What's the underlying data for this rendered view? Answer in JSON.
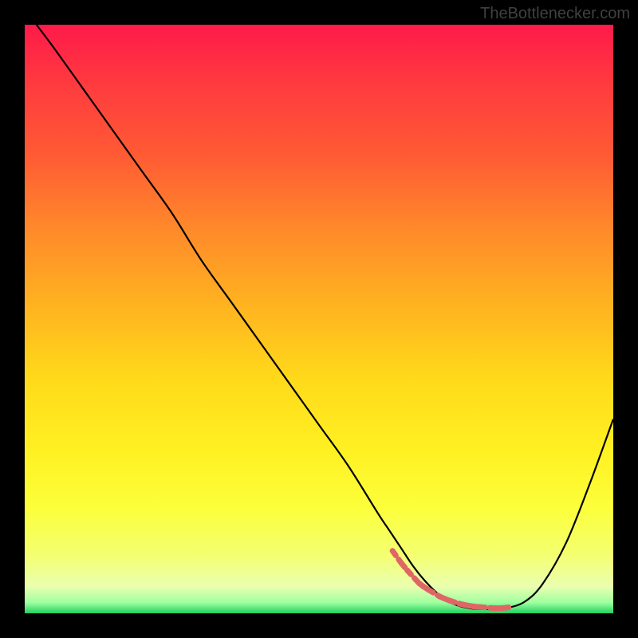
{
  "attribution": "TheBottlenecker.com",
  "chart_data": {
    "type": "line",
    "title": "",
    "xlabel": "",
    "ylabel": "",
    "xlim": [
      0,
      100
    ],
    "ylim": [
      0,
      100
    ],
    "grid": false,
    "series": [
      {
        "name": "bottleneck-curve",
        "color": "#000000",
        "x": [
          2,
          5,
          10,
          15,
          20,
          25,
          30,
          35,
          40,
          45,
          50,
          55,
          60,
          62,
          64,
          66,
          68,
          70,
          72,
          74,
          76,
          78,
          80,
          82,
          85,
          88,
          92,
          96,
          100
        ],
        "y": [
          100,
          96,
          89,
          82,
          75,
          68,
          60,
          53,
          46,
          39,
          32,
          25,
          17,
          14,
          11,
          8,
          5.5,
          3.5,
          2,
          1.2,
          0.8,
          0.7,
          0.7,
          0.9,
          2,
          5,
          12,
          22,
          33
        ]
      }
    ],
    "markers": {
      "name": "highlight-segment",
      "color": "#e06666",
      "style": "dashed",
      "x": [
        62.5,
        64,
        65,
        67,
        67.8,
        68.6,
        70.5,
        71.3,
        72.2,
        73.8,
        74.6,
        75.4,
        76.3,
        77.3,
        80,
        81.3,
        82.2
      ],
      "y": [
        10.6,
        8.5,
        7.3,
        5.1,
        4.5,
        4.0,
        2.85,
        2.5,
        2.15,
        1.65,
        1.45,
        1.3,
        1.15,
        1.05,
        0.85,
        0.9,
        1.0
      ]
    },
    "gradient": {
      "stops": [
        {
          "offset": 0.0,
          "color": "#ff1a4a"
        },
        {
          "offset": 0.1,
          "color": "#ff3a3f"
        },
        {
          "offset": 0.22,
          "color": "#ff5a34"
        },
        {
          "offset": 0.35,
          "color": "#ff8a2a"
        },
        {
          "offset": 0.48,
          "color": "#ffb420"
        },
        {
          "offset": 0.6,
          "color": "#ffd91a"
        },
        {
          "offset": 0.72,
          "color": "#fff022"
        },
        {
          "offset": 0.82,
          "color": "#fcff3a"
        },
        {
          "offset": 0.9,
          "color": "#f4ff70"
        },
        {
          "offset": 0.955,
          "color": "#eaffb0"
        },
        {
          "offset": 0.982,
          "color": "#9effa0"
        },
        {
          "offset": 1.0,
          "color": "#20d060"
        }
      ]
    }
  }
}
